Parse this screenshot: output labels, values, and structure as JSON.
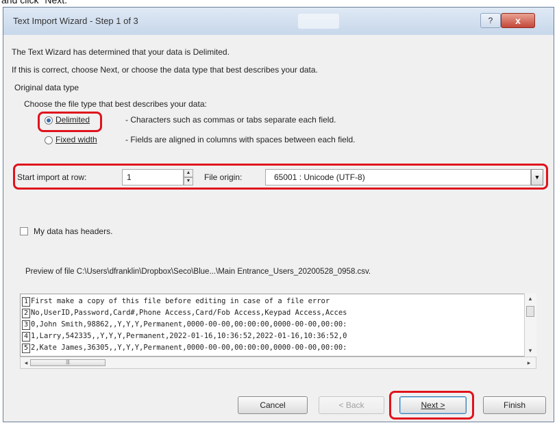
{
  "top_caption": "and click \"Next.\"",
  "window": {
    "title": "Text Import Wizard - Step 1 of 3",
    "help_label": "?",
    "close_label": "x"
  },
  "intro": {
    "line1": "The Text Wizard has determined that your data is Delimited.",
    "line2": "If this is correct, choose Next, or choose the data type that best describes your data."
  },
  "original_data_type": {
    "heading": "Original data type",
    "prompt": "Choose the file type that best describes your data:",
    "options": [
      {
        "label": "Delimited",
        "description": "- Characters such as commas or tabs separate each field.",
        "selected": true
      },
      {
        "label": "Fixed width",
        "description": "- Fields are aligned in columns with spaces between each field.",
        "selected": false
      }
    ]
  },
  "import_settings": {
    "start_row_label": "Start import at row:",
    "start_row_value": "1",
    "file_origin_label": "File origin:",
    "file_origin_value": "65001 : Unicode (UTF-8)"
  },
  "headers_checkbox": {
    "label": "My data has headers.",
    "checked": false
  },
  "preview": {
    "title": "Preview of file C:\\Users\\dfranklin\\Dropbox\\Seco\\Blue...\\Main Entrance_Users_20200528_0958.csv.",
    "rows": [
      {
        "num": "1",
        "text": "First make a copy of this file before editing in case of a file error"
      },
      {
        "num": "2",
        "text": "No,UserID,Password,Card#,Phone Access,Card/Fob Access,Keypad Access,Acces"
      },
      {
        "num": "3",
        "text": "0,John Smith,98862,,Y,Y,Y,Permanent,0000-00-00,00:00:00,0000-00-00,00:00:"
      },
      {
        "num": "4",
        "text": "1,Larry,542335,,Y,Y,Y,Permanent,2022-01-16,10:36:52,2022-01-16,10:36:52,0"
      },
      {
        "num": "5",
        "text": "2,Kate James,36305,,Y,Y,Y,Permanent,0000-00-00,00:00:00,0000-00-00,00:00:"
      }
    ]
  },
  "buttons": {
    "cancel": "Cancel",
    "back": "< Back",
    "next": "Next >",
    "finish": "Finish"
  },
  "colors": {
    "highlight": "#e0121c",
    "dialog_bg": "#f0f0f0"
  }
}
